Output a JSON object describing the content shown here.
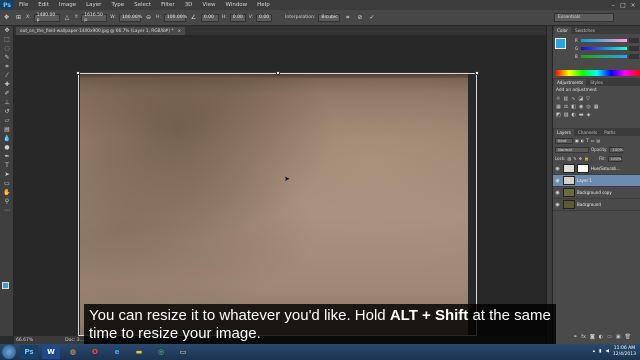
{
  "app": {
    "logo": "Ps",
    "menu": [
      "File",
      "Edit",
      "Image",
      "Layer",
      "Type",
      "Select",
      "Filter",
      "3D",
      "View",
      "Window",
      "Help"
    ]
  },
  "options": {
    "x_label": "X:",
    "x_value": "1480.00 p",
    "y_label": "Y:",
    "y_value": "1616.50 p",
    "w_label": "W:",
    "w_value": "100.00%",
    "h_label": "H:",
    "h_value": "100.00%",
    "angle_value": "0.00",
    "h_skew_label": "H:",
    "h_skew_value": "0.00",
    "v_skew_label": "V:",
    "v_skew_value": "0.00",
    "interpolation_label": "Interpolation:",
    "interpolation_value": "Bicubic",
    "workspace": "Essentials"
  },
  "document": {
    "tab_title": "out_on_the_field-wallpaper-1440x900.jpg @ 66.7% (Layer 1, RGB/8#) *"
  },
  "status": {
    "zoom": "66.67%",
    "doc_info": "Doc: 3..."
  },
  "panels": {
    "color_tabs": [
      "Color",
      "Swatches"
    ],
    "slider_labels": [
      "R",
      "G",
      "B"
    ],
    "slider_values": [
      "",
      "",
      ""
    ],
    "adjust_tabs": [
      "Adjustments",
      "Styles"
    ],
    "adjust_title": "Add an adjustment",
    "layers_tabs": [
      "Layers",
      "Channels",
      "Paths"
    ],
    "kind_label": "Kind",
    "blend_mode": "Normal",
    "opacity_label": "Opacity:",
    "opacity_value": "100%",
    "lock_label": "Lock:",
    "fill_label": "Fill:",
    "fill_value": "100%",
    "layers": [
      {
        "name": "Hue/Saturati...",
        "selected": false
      },
      {
        "name": "Layer 1",
        "selected": true
      },
      {
        "name": "Background copy",
        "selected": false
      },
      {
        "name": "Background",
        "selected": false
      }
    ]
  },
  "caption": {
    "part1": "You can resize it to whatever you'd like. Hold ",
    "bold": "ALT + Shift",
    "part2": " at the same time to resize your image."
  },
  "taskbar": {
    "time": "11:06 AM",
    "date": "12/4/2013"
  },
  "colors": {
    "foreground": "#29a3d8",
    "background": "#ffffff",
    "selected_layer": "#6c8bb0"
  }
}
